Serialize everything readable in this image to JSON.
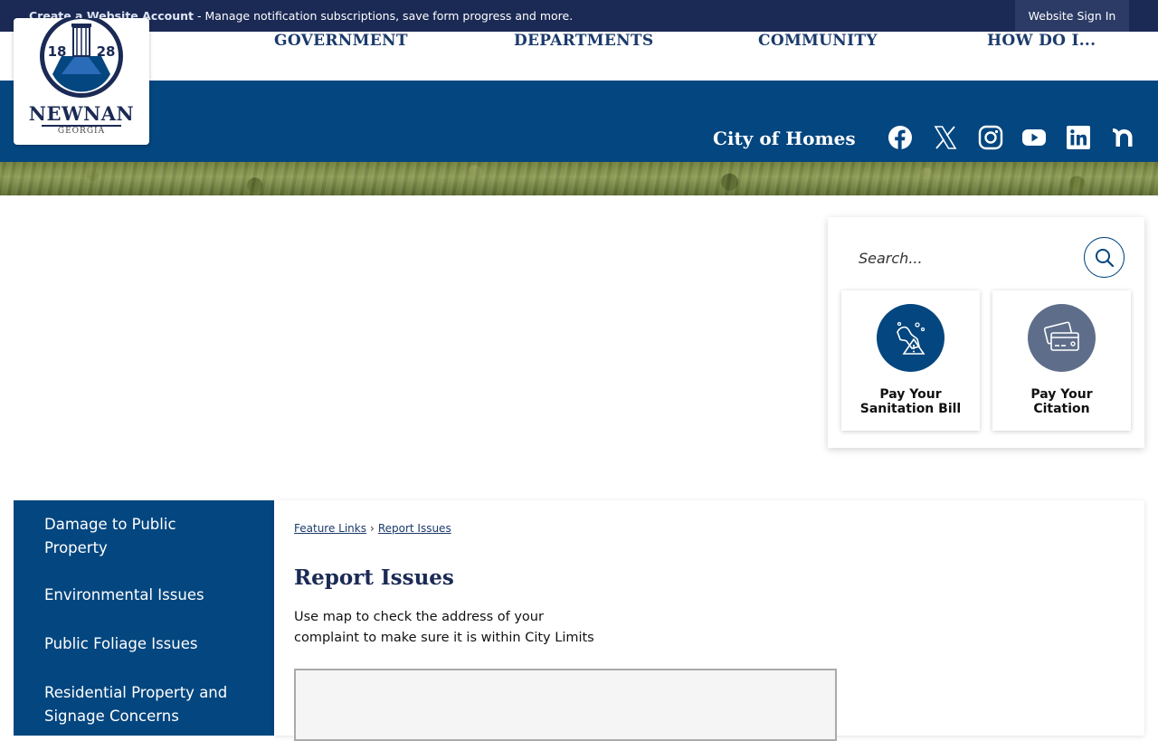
{
  "topbar": {
    "create_account": "Create a Website Account",
    "message": " - Manage notification subscriptions, save form progress and more.",
    "signin": "Website Sign In"
  },
  "logo": {
    "year_left": "18",
    "year_right": "28",
    "name": "NEWNAN",
    "subtitle": "GEORGIA"
  },
  "nav": {
    "items": [
      "GOVERNMENT",
      "DEPARTMENTS",
      "COMMUNITY",
      "HOW DO I..."
    ]
  },
  "header": {
    "tagline": "City of Homes"
  },
  "social": [
    "facebook-icon",
    "x-twitter-icon",
    "instagram-icon",
    "youtube-icon",
    "linkedin-icon",
    "nextdoor-icon"
  ],
  "search": {
    "placeholder": "Search..."
  },
  "quick_links": [
    {
      "label_line1": "Pay Your",
      "label_line2": "Sanitation Bill",
      "icon": "sanitation-icon",
      "color": "#04467f"
    },
    {
      "label_line1": "Pay Your",
      "label_line2": "Citation",
      "icon": "credit-card-icon",
      "color": "#5e6e8a"
    }
  ],
  "sidebar": {
    "items": [
      {
        "line1": "Damage to Public",
        "line2": "Property"
      },
      {
        "line1": "Environmental Issues",
        "line2": ""
      },
      {
        "line1": "Public Foliage Issues",
        "line2": ""
      },
      {
        "line1": "Residential Property and",
        "line2": "Signage Concerns"
      }
    ]
  },
  "breadcrumb": {
    "items": [
      "Feature Links",
      "Report Issues"
    ]
  },
  "main": {
    "title": "Report Issues",
    "desc_line1": "Use map to check the address of your",
    "desc_line2": "complaint to make sure it is within City Limits"
  },
  "colors": {
    "navy": "#1b2a55",
    "brand_blue": "#04467f",
    "slate": "#5e6e8a"
  }
}
